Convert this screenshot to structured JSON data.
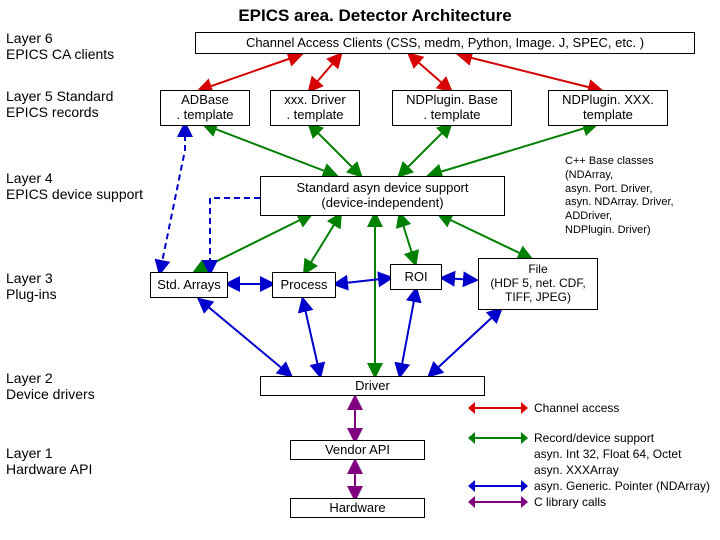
{
  "title": "EPICS area. Detector Architecture",
  "layers": {
    "l6": "Layer 6\nEPICS CA clients",
    "l5": "Layer 5 Standard EPICS records",
    "l4": "Layer 4\nEPICS device support",
    "l3": "Layer 3\nPlug-ins",
    "l2": "Layer 2\nDevice drivers",
    "l1": "Layer 1\nHardware API"
  },
  "boxes": {
    "ca_clients": "Channel Access Clients (CSS, medm, Python, Image. J, SPEC, etc. )",
    "adbase": "ADBase\n. template",
    "xxxdriver": "xxx. Driver\n. template",
    "ndpluginbase": "NDPlugin. Base\n. template",
    "ndpluginxxx": "NDPlugin. XXX.\ntemplate",
    "asyn_support": "Standard asyn device support\n(device-independent)",
    "stdarrays": "Std. Arrays",
    "process": "Process",
    "roi": "ROI",
    "file": "File\n(HDF 5, net. CDF,\nTIFF, JPEG)",
    "driver": "Driver",
    "vendor_api": "Vendor API",
    "hardware": "Hardware"
  },
  "annotation": "C++ Base classes\n(NDArray,\nasyn. Port. Driver,\nasyn. NDArray. Driver,\nADDriver,\nNDPlugin. Driver)",
  "legend": {
    "ca": "Channel access",
    "rec1": "Record/device support",
    "rec2": "asyn. Int 32, Float 64, Octet",
    "rec3": "asyn. XXXArray",
    "gp": "asyn. Generic. Pointer (NDArray)",
    "clib": "C library calls"
  },
  "colors": {
    "red": "#d60000",
    "green": "#008000",
    "blue": "#0000cc",
    "purple": "#800080"
  }
}
